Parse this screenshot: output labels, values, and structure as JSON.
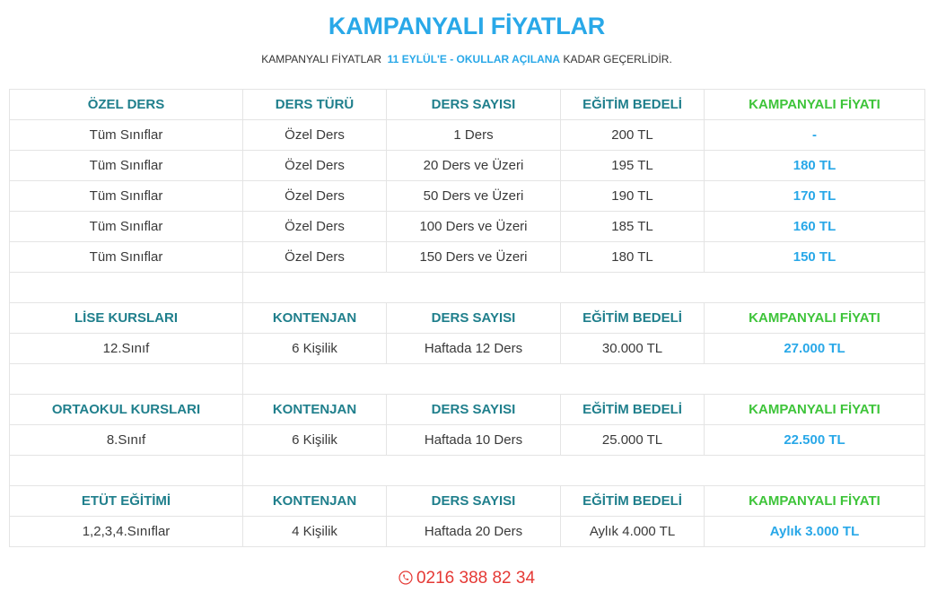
{
  "title": "KAMPANYALI FİYATLAR",
  "subtitle": {
    "prefix": "KAMPANYALI FİYATLAR",
    "highlight": "11 EYLÜL'E - OKULLAR AÇILANA",
    "suffix": "KADAR GEÇERLİDİR."
  },
  "colors": {
    "accent_blue": "#29a8e8",
    "header_teal": "#1f7f8c",
    "header_green": "#3ec43a",
    "phone_red": "#e53935"
  },
  "private_lessons": {
    "headers": [
      "ÖZEL DERS",
      "DERS TÜRÜ",
      "DERS SAYISI",
      "EĞİTİM BEDELİ",
      "KAMPANYALI FİYATI"
    ],
    "rows": [
      [
        "Tüm Sınıflar",
        "Özel Ders",
        "1 Ders",
        "200 TL",
        "-"
      ],
      [
        "Tüm Sınıflar",
        "Özel Ders",
        "20 Ders ve Üzeri",
        "195 TL",
        "180 TL"
      ],
      [
        "Tüm Sınıflar",
        "Özel Ders",
        "50 Ders ve Üzeri",
        "190 TL",
        "170 TL"
      ],
      [
        "Tüm Sınıflar",
        "Özel Ders",
        "100 Ders ve Üzeri",
        "185 TL",
        "160 TL"
      ],
      [
        "Tüm Sınıflar",
        "Özel Ders",
        "150 Ders ve Üzeri",
        "180 TL",
        "150 TL"
      ]
    ]
  },
  "high_school": {
    "headers": [
      "LİSE KURSLARI",
      "KONTENJAN",
      "DERS SAYISI",
      "EĞİTİM BEDELİ",
      "KAMPANYALI FİYATI"
    ],
    "rows": [
      [
        "12.Sınıf",
        "6 Kişilik",
        "Haftada 12 Ders",
        "30.000 TL",
        "27.000 TL"
      ]
    ]
  },
  "middle_school": {
    "headers": [
      "ORTAOKUL KURSLARI",
      "KONTENJAN",
      "DERS SAYISI",
      "EĞİTİM BEDELİ",
      "KAMPANYALI FİYATI"
    ],
    "rows": [
      [
        "8.Sınıf",
        "6 Kişilik",
        "Haftada 10 Ders",
        "25.000 TL",
        "22.500 TL"
      ]
    ]
  },
  "tutoring": {
    "headers": [
      "ETÜT EĞİTİMİ",
      "KONTENJAN",
      "DERS SAYISI",
      "EĞİTİM BEDELİ",
      "KAMPANYALI FİYATI"
    ],
    "rows": [
      [
        "1,2,3,4.Sınıflar",
        "4 Kişilik",
        "Haftada 20 Ders",
        "Aylık 4.000 TL",
        "Aylık 3.000 TL"
      ]
    ]
  },
  "phone": {
    "icon": "phone-icon",
    "number": "0216 388 82 34"
  }
}
